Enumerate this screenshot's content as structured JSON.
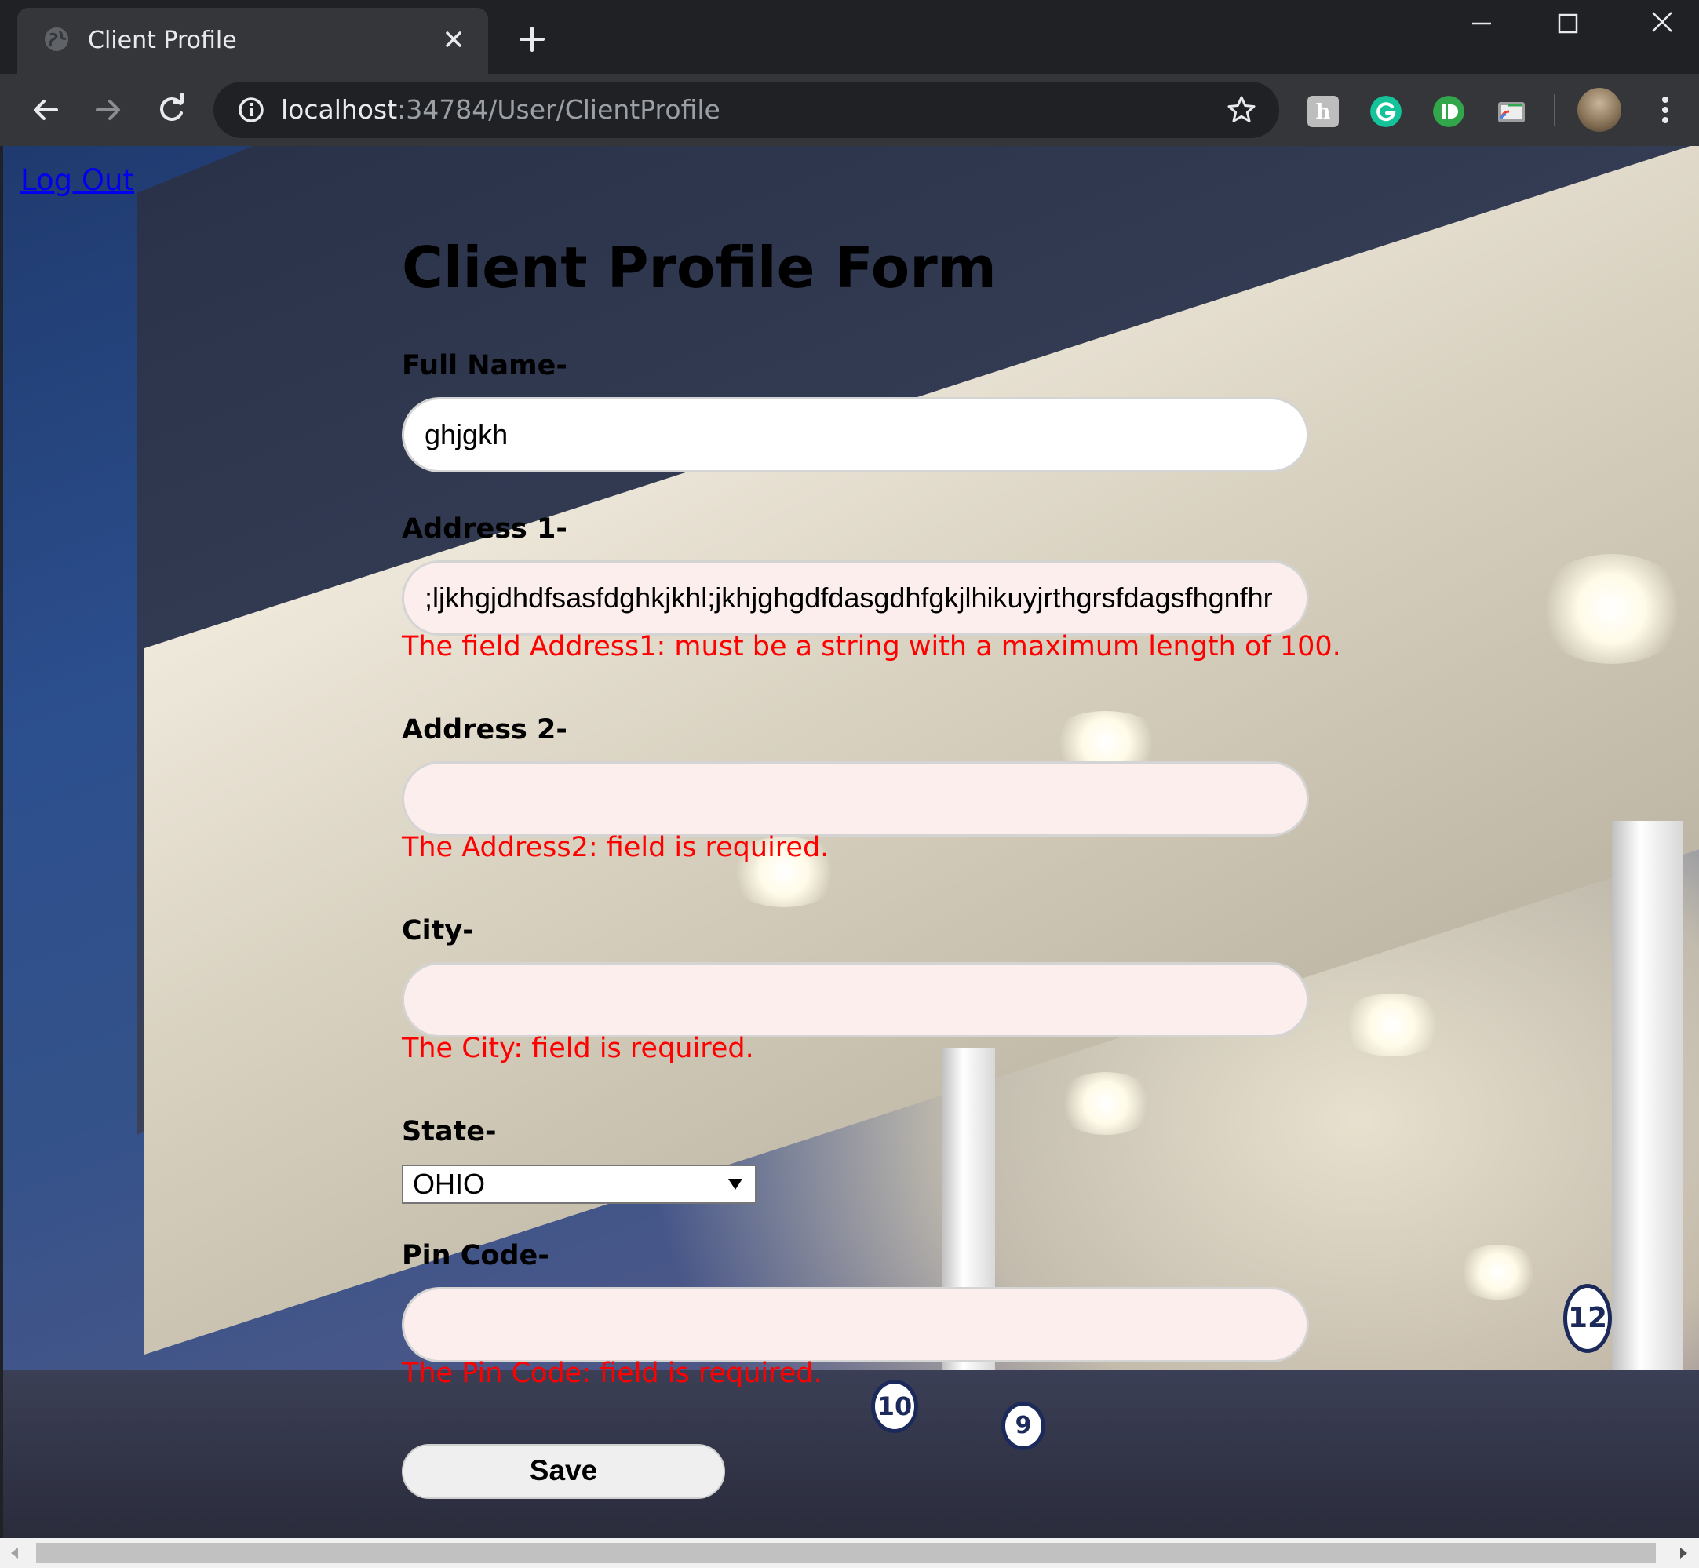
{
  "browser": {
    "tab": {
      "title": "Client Profile"
    },
    "url": {
      "host": "localhost",
      "rest": ":34784/User/ClientProfile"
    },
    "icons": {
      "favicon": "globe-icon",
      "tab_close": "close-icon",
      "new_tab": "plus-icon",
      "minimize": "minimize-icon",
      "maximize": "maximize-icon",
      "close": "close-icon",
      "back": "back-arrow-icon",
      "forward": "forward-arrow-icon",
      "reload": "reload-icon",
      "site_info": "info-icon",
      "bookmark": "star-icon",
      "menu": "kebab-menu-icon"
    },
    "extensions": [
      "honey-extension-icon",
      "grammarly-extension-icon",
      "dashlane-extension-icon",
      "chromecast-extension-icon"
    ],
    "colors": {
      "frame": "#202124",
      "toolbar": "#35363a",
      "text": "#e8eaed",
      "url_muted": "#9aa0a6"
    }
  },
  "page": {
    "logout_label": "Log Out",
    "title": "Client Profile Form",
    "fields": {
      "full_name": {
        "label": "Full Name-",
        "value": "ghjgkh"
      },
      "address1": {
        "label": "Address 1-",
        "value": ";ljkhgjdhdfsasfdghkjkhl;jkhjghgdfdasgdhfgkjlhikuyjrthgrsfdagsfhgnfhr",
        "error": "The field Address1: must be a string with a maximum length of 100."
      },
      "address2": {
        "label": "Address 2-",
        "value": "",
        "error": "The Address2: field is required."
      },
      "city": {
        "label": "City-",
        "value": "",
        "error": "The City: field is required."
      },
      "state": {
        "label": "State-",
        "selected": "OHIO"
      },
      "pin_code": {
        "label": "Pin Code-",
        "value": "",
        "error": "The Pin Code: field is required."
      }
    },
    "save_label": "Save",
    "background_badges": [
      "10",
      "9",
      "12"
    ],
    "colors": {
      "link": "#0000ee",
      "error": "#ff0000",
      "invalid_bg": "#fdeeee"
    }
  }
}
